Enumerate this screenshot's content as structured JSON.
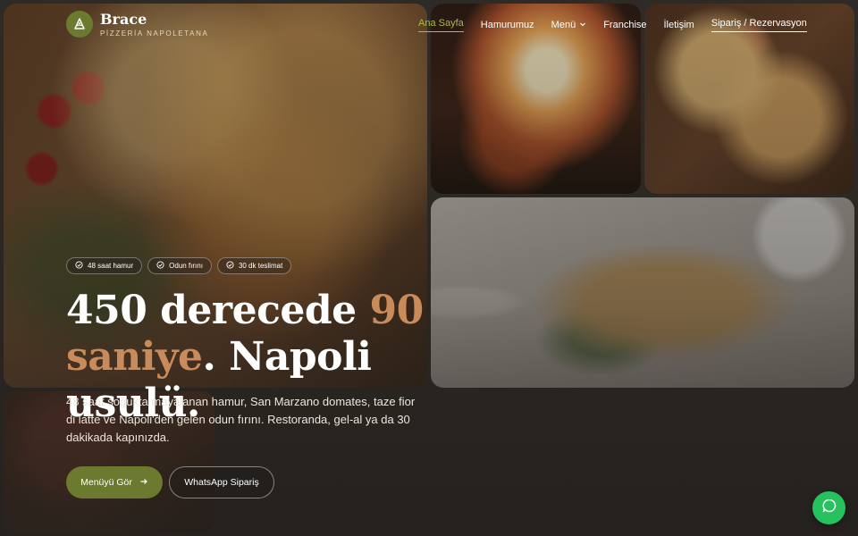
{
  "brand": {
    "name": "Brace",
    "tagline": "PİZZERİA NAPOLETANA",
    "logo_icon": "pizza-slice-icon"
  },
  "nav": {
    "items": [
      {
        "label": "Ana Sayfa",
        "active": true
      },
      {
        "label": "Hamurumuz"
      },
      {
        "label": "Menü",
        "has_dropdown": true
      },
      {
        "label": "Franchise"
      },
      {
        "label": "İletişim"
      },
      {
        "label": "Sipariş / Rezervasyon"
      }
    ]
  },
  "badges": [
    {
      "label": "48 saat hamur",
      "icon": "check-circle-icon"
    },
    {
      "label": "Odun fırını",
      "icon": "check-circle-icon"
    },
    {
      "label": "30 dk teslimat",
      "icon": "check-circle-icon"
    }
  ],
  "hero": {
    "headline_part1": "450 derecede ",
    "headline_accent1": "90",
    "headline_accent2": "saniye",
    "headline_part2": ". Napoli usulü.",
    "description": "48 saat soğukta mayalanan hamur, San Marzano domates, taze fior di latte ve Napoli'den gelen odun fırını. Restoranda, gel-al ya da 30 dakikada kapınızda."
  },
  "buttons": {
    "menu_label": "Menüyü Gör",
    "whatsapp_label": "WhatsApp Sipariş"
  },
  "colors": {
    "accent_green": "#6b7a2e",
    "nav_active": "#a9b94a",
    "headline_accent": "#c98b5a",
    "whatsapp_green": "#27c15e"
  }
}
